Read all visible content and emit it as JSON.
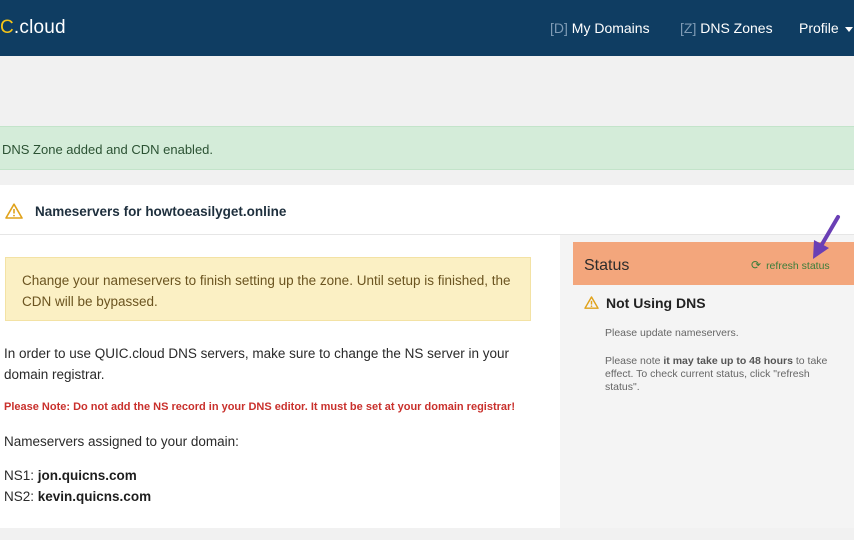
{
  "nav": {
    "brand_prefix": "C",
    "brand_suffix": ".cloud",
    "domains_key": "[D]",
    "domains_label": "My Domains",
    "zones_key": "[Z]",
    "zones_label": "DNS Zones",
    "profile_label": "Profile"
  },
  "alert": {
    "message": "DNS Zone added and CDN enabled."
  },
  "card": {
    "title": "Nameservers for howtoeasilyget.online",
    "notice": "Change your nameservers to finish setting up the zone. Until setup is finished, the CDN will be bypassed.",
    "instructions": "In order to use QUIC.cloud DNS servers, make sure to change the NS server in your domain registrar.",
    "warning": "Please Note: Do not add the NS record in your DNS editor. It must be set at your domain registrar!",
    "assigned_label": "Nameservers assigned to your domain:",
    "nameservers": [
      {
        "label": "NS1:",
        "value": "jon.quicns.com"
      },
      {
        "label": "NS2:",
        "value": "kevin.quicns.com"
      }
    ]
  },
  "status": {
    "title": "Status",
    "refresh_label": "refresh status",
    "state": "Not Using DNS",
    "message1": "Please update nameservers.",
    "message2_pre": "Please note ",
    "message2_bold": "it may take up to 48 hours",
    "message2_post": " to take effect. To check current status, click \"refresh status\"."
  },
  "colors": {
    "navbar": "#0f3d62",
    "success_bg": "#d4ecd9",
    "notice_bg": "#fbf0c4",
    "status_header": "#f3a67c",
    "warning_text": "#c9302c",
    "annotation_arrow": "#6a3fb5"
  },
  "icons": [
    "warning-icon",
    "refresh-icon",
    "annotation-arrow"
  ]
}
